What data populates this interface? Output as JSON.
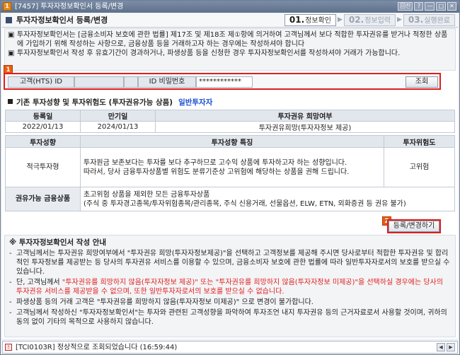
{
  "window": {
    "app_badge": "1",
    "title": "[7457] 투자자정보확인서 등록/변경",
    "buttons": [
      "回전",
      "?",
      "—",
      "□",
      "✕"
    ]
  },
  "header": {
    "page_title": "투자자정보확인서 등록/변경",
    "steps": [
      {
        "num": "01.",
        "label": "정보확인"
      },
      {
        "num": "02.",
        "label": "정보입력"
      },
      {
        "num": "03.",
        "label": "실행완료"
      }
    ]
  },
  "notice": {
    "lines": [
      "투자자정보확인서는 [금융소비자 보호에 관한 법률] 제17조 및 제18조 제①항에 의거하여 고객님께서 보다 적합한 투자권유를 받거나 적정한 상품에 가입하기 위해 작성하는 사항으로, 금융상품 등을 거래하고자 하는 경우에는 작성하셔야 합니다",
      "투자자정보확인서 작성 후 유효기간이 경과하거나, 파생상품 등을 신청한 경우 투자자정보확인서를 작성하셔야 거래가 가능합니다."
    ]
  },
  "search": {
    "badge": "1",
    "customer_id_label": "고객(HTS) ID",
    "customer_id_value": "",
    "id_field_blank": "",
    "password_label": "ID 비밀번호",
    "password_value": "************",
    "query_button": "조회"
  },
  "existing": {
    "title": "기존 투자성향 및 투자위험도 (투자권유가능 상품)",
    "investor_type_tag": "일반투자자",
    "summary_headers": [
      "등록일",
      "만기일",
      "투자권유 희망여부"
    ],
    "summary_values": [
      "2022/01/13",
      "2024/01/13",
      "투자권유희망(투자자정보 제공)"
    ],
    "detail_headers": [
      "투자성향",
      "투자성향 특징",
      "투자위험도"
    ],
    "propensity": "적극투자형",
    "propensity_desc": "투자원금 보존보다는 투자를 보다 추구하므로 고수익 상품에 투자하고자 하는 성향입니다.\n따라서, 당사 금융투자상품별 위험도 분류기준상 고위험에 해당하는 상품을 권해 드립니다.",
    "risk_level": "고위험",
    "allowed_label": "권유가능 금융상품",
    "allowed_desc": "초고위험 상품을 제외한 모든 금융투자상품\n(주식 중 투자경고종목/투자위험종목/관리종목, 주식 신용거래, 선물옵션, ELW, ETN, 외화증권 등 권유 불가)"
  },
  "register": {
    "badge": "2",
    "button": "등록/변경하기"
  },
  "guide": {
    "title": "※ 투자자정보확인서 작성 안내",
    "items": [
      {
        "pre": "고객님께서는 투자권유 희망여부에서 \"투자권유 희망(투자자정보제공)\"을 선택하고 고객정보를 제공해 주시면 당사로부터 적합한 투자권유 및 합리적인 투자정보를 제공받는 등 당사의 투자권유 서비스를 이용할 수 있으며, 금융소비자 보호에 관한 법률에 따라 일반투자자로서의 보호를 받으실 수 있습니다.",
        "red": "",
        "post": ""
      },
      {
        "pre": "단, 고객님께서 ",
        "red": "\"투자권유를 희망하지 않음(투자자정보 제공)\" 또는 \"투자권유를 희망하지 않음(투자자정보 미제공)\"을 선택하실 경우에는 당사의 투자권유 서비스를 제공받을 수 없으며, 또한 일반투자자로서의 보호를 받으실 수 없습니다.",
        "post": ""
      },
      {
        "pre": "파생상품 등의 거래 고객은 \"투자권유를 희망하지 않음(투자자정보 미제공)\" 으로 변경이 불가합니다.",
        "red": "",
        "post": ""
      },
      {
        "pre": "고객님께서 작성하신 \"투자자정보확인서\"는 투자와 관련된 고객성향을 파악하여 투자조언 내지 투자권유 등의 근거자료로서 사용할 것이며, 귀하의 동의 없이 기타의 목적으로 사용하지 않습니다.",
        "red": "",
        "post": ""
      }
    ]
  },
  "status": {
    "message": "[TCI0103R] 정상적으로 조회되었습니다 (16:59:44)"
  }
}
